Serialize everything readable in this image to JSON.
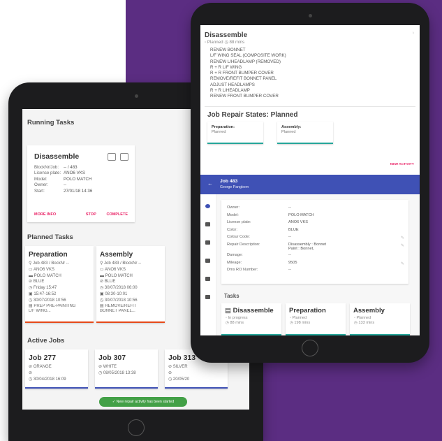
{
  "running": {
    "section_title": "Running Tasks",
    "card": {
      "title": "Disassemble",
      "fields": [
        {
          "k": "BlockNr/Job:",
          "v": "-- / 483"
        },
        {
          "k": "License plate:",
          "v": "ANO6 VKS"
        },
        {
          "k": "Model:",
          "v": "POLO MATCH"
        },
        {
          "k": "Owner:",
          "v": "--"
        },
        {
          "k": "Start:",
          "v": "27/01/18 14:36"
        }
      ],
      "more_info": "MORE INFO",
      "stop": "STOP",
      "complete": "COMPLETE"
    }
  },
  "planned": {
    "section_title": "Planned Tasks",
    "cards": [
      {
        "title": "Preparation",
        "lines": [
          "⚲ Job 483 / BockNr --",
          "▭ ANO6 VKS",
          "▬ POLO MATCH",
          "⊘ BLUE",
          "◷ Friday 15:47",
          "▣ 15:47-16:52",
          "◷ 30/07/2018 10:56",
          "▤ PREP PRE-PAINTING",
          "   L/F WING..."
        ]
      },
      {
        "title": "Assembly",
        "lines": [
          "⚲ Job 483 / BlockNr --",
          "▭ ANO6 VKS",
          "▬ POLO MATCH",
          "⊘ BLUE",
          "◷ 30/07/2018 06:00",
          "▣ 08:30-10:01",
          "◷ 30/07/2018 10:56",
          "▤ REMOVE/REFIT",
          "   BONNET PANEL..."
        ]
      }
    ]
  },
  "active": {
    "section_title": "Active Jobs",
    "jobs": [
      {
        "title": "Job 277",
        "color": "⊘ ORANGE",
        "extra": "⊘",
        "date": "◷ 30/04/2018 16:09"
      },
      {
        "title": "Job 307",
        "color": "⊘ WHITE",
        "extra": "",
        "date": "◷ 08/05/2018 13:38"
      },
      {
        "title": "Job 313",
        "color": "⊘ SILVER",
        "extra": "⊘",
        "date": "◷ 20/05/20"
      }
    ]
  },
  "toast": "✓  New repair activity has been started",
  "detail": {
    "title": "Disassemble",
    "status": "◦ Planned  ◷ 88 mins",
    "tasks": [
      "RENEW BONNET",
      "L/F WING SEAL (COMPOSITE WORK)",
      "RENEW L/HEADLAMP (REMOVED)",
      "R + R L/F WING",
      "R + R FRONT BUMPER COVER",
      "REMOVE/REFIT BONNET PANEL",
      "ADJUST HEADLAMPS",
      "R + R L/HEADLAMP",
      "RENEW FRONT BUMPER COVER"
    ],
    "repair_status": "Job Repair States: Planned",
    "prep_label": "Preparation:",
    "prep_val": "Planned",
    "asm_label": "Assembly:",
    "asm_val": "Planned",
    "new_activity": "NEW ACTIVITY"
  },
  "nav": {
    "back": "←",
    "job": "Job 483",
    "person": "George Pangborn"
  },
  "vehicle": [
    {
      "k": "Owner:",
      "v": "--"
    },
    {
      "k": "Model:",
      "v": "POLO MATCH"
    },
    {
      "k": "License plate:",
      "v": "ANO6 VKS"
    },
    {
      "k": "Color:",
      "v": "BLUE"
    },
    {
      "k": "Colour Code:",
      "v": "--"
    },
    {
      "k": "Repair Description:",
      "v": "Disassembly : Bonnet\nPaint : Bonnet,"
    },
    {
      "k": "Damage:",
      "v": "--"
    },
    {
      "k": "Mileage:",
      "v": "9505"
    },
    {
      "k": "Dms RO Number:",
      "v": "--"
    }
  ],
  "tasks_panel": {
    "header": "Tasks",
    "cards": [
      {
        "title": "▤ Disassemble",
        "l1": "◦ In progress",
        "l2": "◷ 88 mins"
      },
      {
        "title": "Preparation",
        "l1": "◦ Planned",
        "l2": "◷ 198 mins"
      },
      {
        "title": "Assembly",
        "l1": "◦ Planned",
        "l2": "◷ 133 mins"
      }
    ]
  }
}
